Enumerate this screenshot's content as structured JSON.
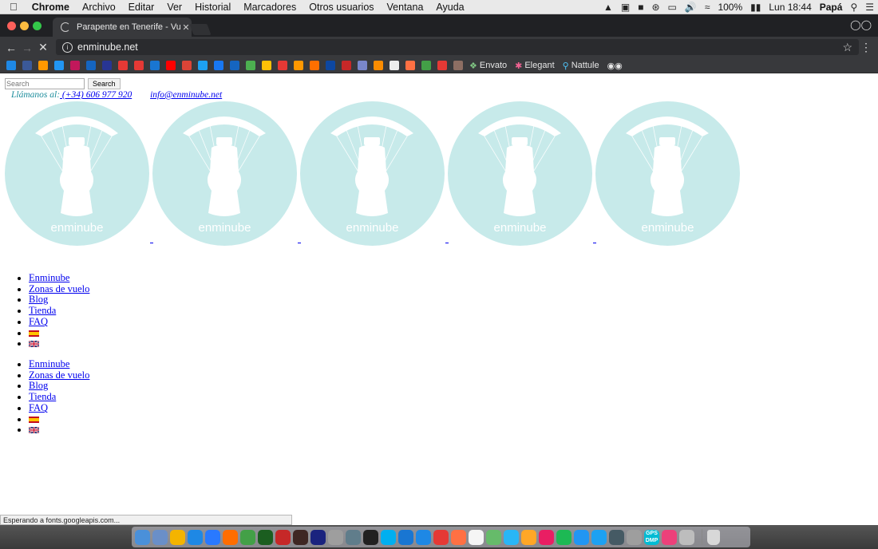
{
  "menubar": {
    "app": "Chrome",
    "items": [
      "Archivo",
      "Editar",
      "Ver",
      "Historial",
      "Marcadores",
      "Otros usuarios",
      "Ventana",
      "Ayuda"
    ],
    "battery": "100%",
    "clock": "Lun 18:44",
    "user": "Papá"
  },
  "tab": {
    "title": "Parapente en Tenerife - Vuelos"
  },
  "omnibox": {
    "url": "enminube.net"
  },
  "bookmarks": {
    "named": [
      "Envato",
      "Elegant",
      "Nattule"
    ],
    "icon_colors": [
      "#1e88e5",
      "#3b5998",
      "#ff9800",
      "#2196f3",
      "#c2185b",
      "#1565c0",
      "#283593",
      "#e53935",
      "#e53935",
      "#1976d2",
      "#ff0000",
      "#db4437",
      "#1da1f2",
      "#1877f2",
      "#1565c0",
      "#4caf50",
      "#ffc107",
      "#e53935",
      "#ff9800",
      "#ff6f00",
      "#0d47a1",
      "#c62828",
      "#7986cb",
      "#fb8c00",
      "#eeeeee",
      "#ff7043",
      "#43a047",
      "#e53935",
      "#8d6e63"
    ]
  },
  "page": {
    "search_placeholder": "Search",
    "search_button": "Search",
    "call_label": "Llámanos al:",
    "phone": " (+34) 606 977 920",
    "email": "info@enminube.net",
    "logo_text": "enminube",
    "nav1": [
      "Enminube",
      "Zonas de vuelo",
      "Blog",
      "Tienda",
      "FAQ"
    ],
    "nav2": [
      "Enminube",
      "Zonas de vuelo",
      "Blog",
      "Tienda",
      "FAQ"
    ]
  },
  "status": "Esperando a fonts.googleapis.com...",
  "dock": {
    "colors": [
      "#4a90d9",
      "#6a8fc8",
      "#f4b400",
      "#1e88e5",
      "#2979ff",
      "#ff6d00",
      "#43a047",
      "#1b5e20",
      "#c62828",
      "#3e2723",
      "#1a237e",
      "#9e9e9e",
      "#607d8b",
      "#212121",
      "#00aff0",
      "#1976d2",
      "#1e88e5",
      "#e53935",
      "#ff7043",
      "#f5f5f5",
      "#66bb6a",
      "#29b6f6",
      "#ffa726",
      "#e91e63",
      "#1db954",
      "#2196f3",
      "#1da1f2",
      "#455a64",
      "#9e9e9e",
      "#00bcd4",
      "#ec407a",
      "#bdbdbd"
    ],
    "gps_label": "GPS DMP"
  },
  "colors": {
    "logo_fill": "#c7eaea",
    "logo_text": "#ffffff",
    "link": "#0000ee",
    "teal_text": "#1d8d9c"
  }
}
